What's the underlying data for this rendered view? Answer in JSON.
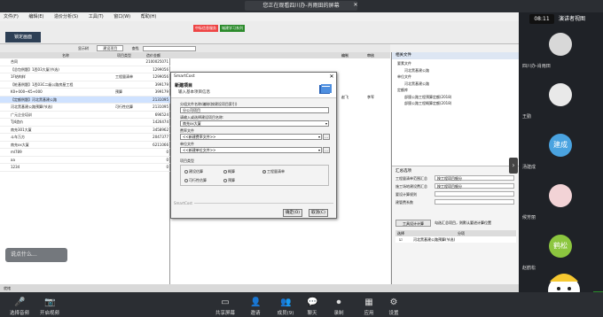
{
  "meeting": {
    "banner": "您正在观看四川办-肖雨田的屏幕",
    "banner_close": "✕",
    "clock": "08:11",
    "view_label": "演讲者视图",
    "side_arrow": "›",
    "chat_placeholder": "说点什么..."
  },
  "app": {
    "menu": [
      "文件(F)",
      "编辑(E)",
      "造价分析(S)",
      "工具(T)",
      "窗口(W)",
      "帮助(H)"
    ],
    "tb_badge1": "中标信息服务",
    "tb_badge2": "城建学习系列",
    "pin_label": "锁定画面",
    "subbar": [
      "显示树",
      "建设项目",
      "查找"
    ],
    "tree_headers": [
      "名称",
      "项目类型",
      "造价金额"
    ],
    "tree_rows": [
      {
        "name": "合同",
        "type": "",
        "amount": "2100025071",
        "sel": false
      },
      {
        "name": "【总包例题】1西03大厦(节选)",
        "type": "",
        "amount": "1299056",
        "sel": false
      },
      {
        "name": "1F结构样",
        "type": "工程量清单",
        "amount": "1299056",
        "sel": false
      },
      {
        "name": "【桩基例题】1西03C二级公路房屋工程",
        "type": "",
        "amount": "399179",
        "sel": false
      },
      {
        "name": "K0+000~K5+000",
        "type": "预算",
        "amount": "399179",
        "sel": false
      },
      {
        "name": "【定额例题】河北黑基建公路",
        "type": "",
        "amount": "2131095",
        "sel": true
      },
      {
        "name": "河北黑基建公路预算(节选)",
        "type": "可行性估算",
        "amount": "2131095",
        "sel": false
      },
      {
        "name": "广元企业培训",
        "type": "",
        "amount": "696524",
        "sel": false
      },
      {
        "name": "TJ4造价",
        "type": "",
        "amount": "1426474",
        "sel": false
      },
      {
        "name": "南充301大厦",
        "type": "",
        "amount": "3458962",
        "sel": false
      },
      {
        "name": "斗车万方",
        "type": "",
        "amount": "2047377",
        "sel": false
      },
      {
        "name": "南充xx大厦",
        "type": "",
        "amount": "6211066",
        "sel": false
      },
      {
        "name": "ml789",
        "type": "",
        "amount": "0",
        "sel": false
      },
      {
        "name": "aa",
        "type": "",
        "amount": "0",
        "sel": false
      },
      {
        "name": "1234",
        "type": "",
        "amount": "0",
        "sel": false
      }
    ],
    "mid_headers": [
      "编制",
      "审核"
    ],
    "mid_values": [
      "赵飞",
      "李军"
    ],
    "right_title": "相关文件",
    "right_rows": [
      "要素文件",
      "河北黑基建公路",
      "单位文件",
      "河北黑基建公路",
      "定额库",
      "部颁公路工程预算定额(2018)",
      "部颁公路工程概算定额(2018)"
    ],
    "rbot_title": "汇总选项",
    "rbot_fields": [
      {
        "label": "工程量清单范围汇总",
        "value": "按工程项目细分"
      },
      {
        "label": "施工场地建设费汇总",
        "value": "按工程项目细分"
      },
      {
        "label": "要设计算规则",
        "value": ""
      },
      {
        "label": "建管费系数",
        "value": ""
      }
    ],
    "rbot_btn1": "工具设计计算",
    "rbot_btn2": "勾选汇总项目，则默认要进计算位置",
    "rbot_list_headers": [
      "选择",
      "分项"
    ],
    "rbot_list_row": "河北黑基建公路预算(节选)",
    "statusbar": "就绪"
  },
  "dialog": {
    "title": "SmartCost",
    "close": "✕",
    "head1": "新建项目",
    "head2": "输入基本项目信息",
    "label_group": "分组文件名称/编制(按建设项目索引)",
    "input_group": "分公司项目",
    "label_name": "请输入或选择建设项目名称:",
    "select_name": "南充xx大厦",
    "label_fee": "费率文件",
    "select_fee": "<<新建费率文件>>",
    "label_unit": "单位文件",
    "select_unit": "<<新建单位文件>>",
    "label_type": "项目类型",
    "types": [
      "建设估算",
      "概算",
      "工程量清单",
      "可行性估算",
      "预算"
    ],
    "selected_type": "工程量清单",
    "brand": "SmartCost",
    "ok": "确定(O)",
    "cancel": "取消(C)"
  },
  "participants": [
    {
      "name": "四川办-肖雨田",
      "color": "#d8d8d8"
    },
    {
      "name": "王勤",
      "color": "#e9e9e9"
    },
    {
      "name": "汤建成",
      "color": "#4aa3e0",
      "initials": "建成"
    },
    {
      "name": "候芳丽",
      "color": "#f2d3d6"
    },
    {
      "name": "赵鹤松",
      "color": "#8cc63f",
      "initials": "鹤松"
    }
  ],
  "bottom": [
    {
      "icon": "mic-icon",
      "glyph": "🎤",
      "label": "选择音频"
    },
    {
      "icon": "camera-icon",
      "glyph": "📷",
      "label": "开启视频"
    },
    {
      "icon": "share-icon",
      "glyph": "▭",
      "label": "共享屏幕"
    },
    {
      "icon": "invite-icon",
      "glyph": "👤",
      "label": "邀请"
    },
    {
      "icon": "members-icon",
      "glyph": "👥",
      "label": "成员(9)"
    },
    {
      "icon": "chat-icon",
      "glyph": "💬",
      "label": "聊天"
    },
    {
      "icon": "record-icon",
      "glyph": "⏺",
      "label": "录制"
    },
    {
      "icon": "apps-icon",
      "glyph": "▦",
      "label": "应用"
    },
    {
      "icon": "settings-icon",
      "glyph": "⚙",
      "label": "设置"
    }
  ]
}
